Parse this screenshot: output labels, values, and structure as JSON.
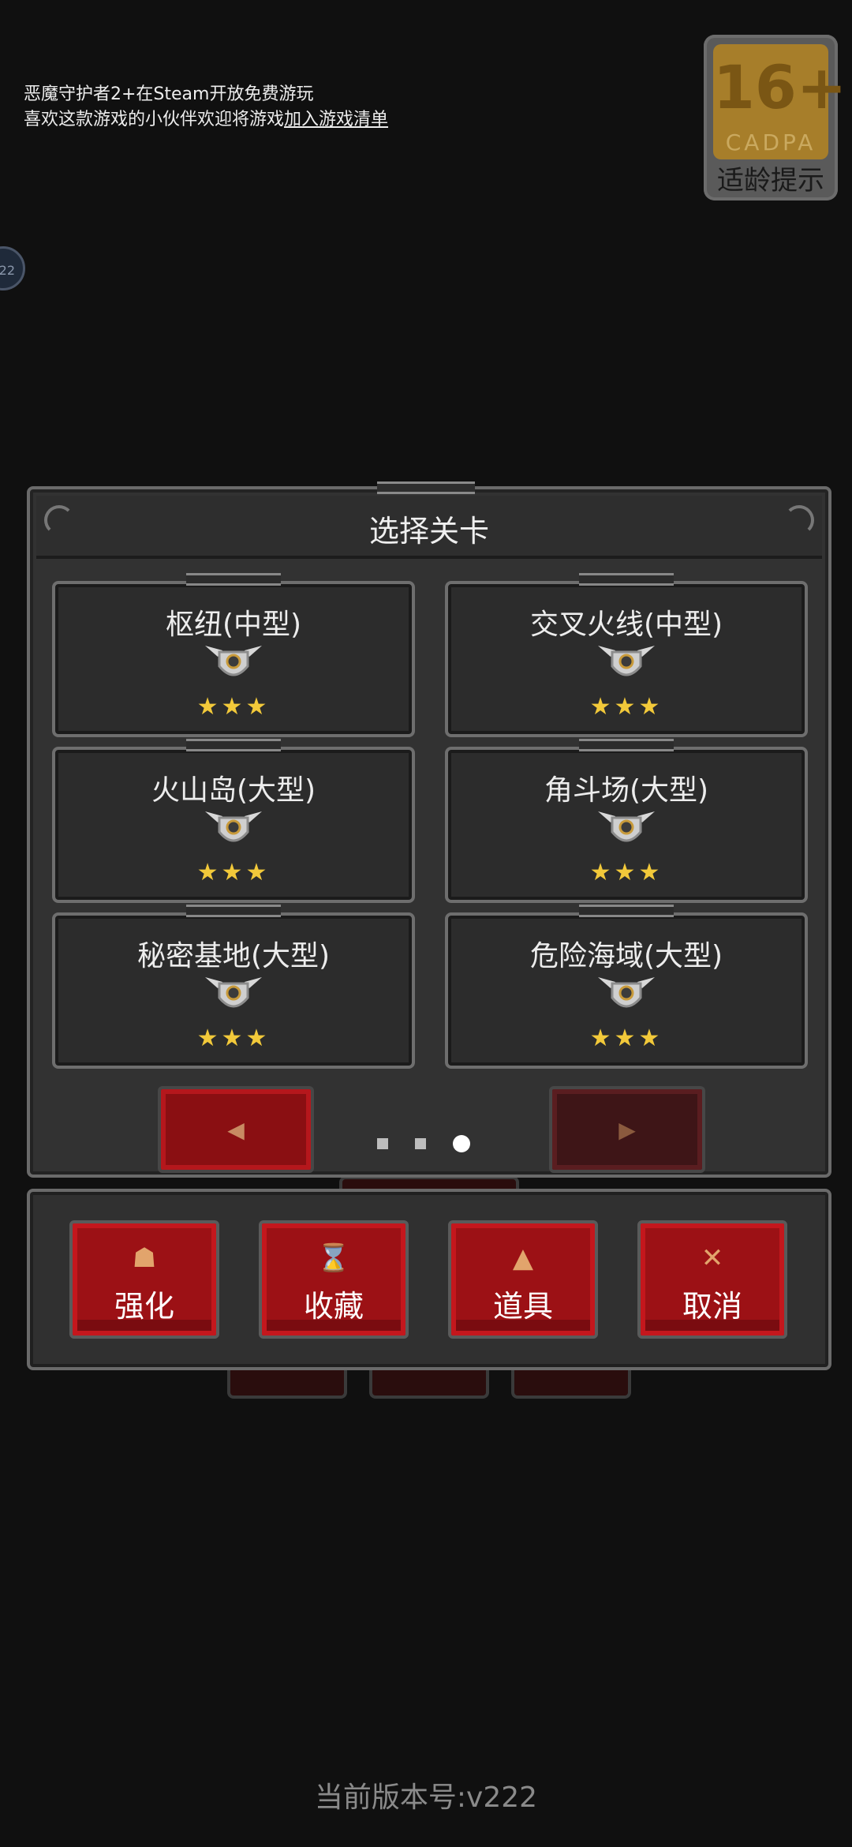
{
  "notice": {
    "line1": "恶魔守护者2+在Steam开放免费游玩",
    "line2_prefix": "喜欢这款游戏的小伙伴欢迎将游戏",
    "line2_link": "加入游戏清单"
  },
  "age_badge": {
    "rating": "16+",
    "org": "CADPA",
    "tip": "适龄提示"
  },
  "side_badge": {
    "text": "22"
  },
  "panel": {
    "title": "选择关卡",
    "levels": [
      {
        "name": "枢纽(中型)",
        "stars": "★★★"
      },
      {
        "name": "交叉火线(中型)",
        "stars": "★★★"
      },
      {
        "name": "火山岛(大型)",
        "stars": "★★★"
      },
      {
        "name": "角斗场(大型)",
        "stars": "★★★"
      },
      {
        "name": "秘密基地(大型)",
        "stars": "★★★"
      },
      {
        "name": "危险海域(大型)",
        "stars": "★★★"
      }
    ],
    "prev_icon": "◀",
    "next_icon": "▶",
    "page_current": 3,
    "page_total": 3
  },
  "actions": [
    {
      "label": "强化",
      "icon": "upgrade-icon",
      "glyph": "☗"
    },
    {
      "label": "收藏",
      "icon": "trophy-icon",
      "glyph": "⌛"
    },
    {
      "label": "道具",
      "icon": "potion-icon",
      "glyph": "▲"
    },
    {
      "label": "取消",
      "icon": "close-icon",
      "glyph": "✕"
    }
  ],
  "version": "当前版本号:v222",
  "colors": {
    "background": "#101010",
    "accent_red": "#9c1115",
    "star": "#f2c93a"
  }
}
